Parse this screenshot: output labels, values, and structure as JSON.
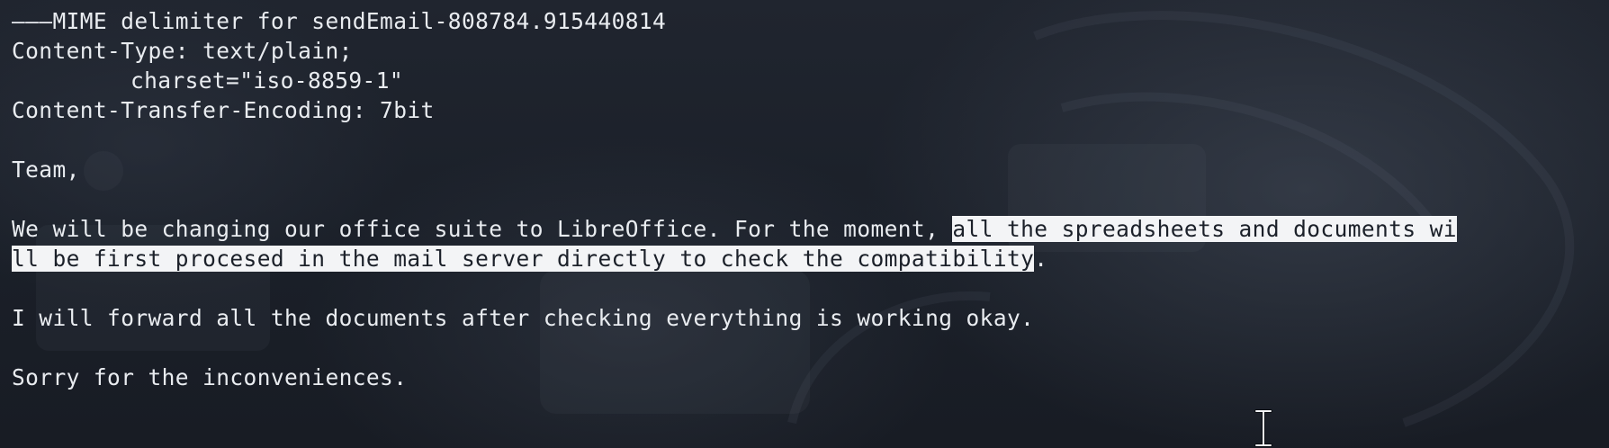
{
  "terminal": {
    "lines": {
      "mime_delimiter": "———MIME delimiter for sendEmail-808784.915440814",
      "content_type": "Content-Type: text/plain;",
      "charset": "charset=\"iso-8859-1\"",
      "encoding": "Content-Transfer-Encoding: 7bit",
      "greeting": "Team,",
      "para1_part1": "We will be changing our office suite to LibreOffice. For the moment, ",
      "para1_selected_1": "all the spreadsheets and documents wi",
      "para1_selected_2": "ll be first procesed in the mail server directly to check the compatibility",
      "para1_end": ".",
      "para2": "I will forward all the documents after checking everything is working okay.",
      "para3": "Sorry for the inconveniences."
    }
  },
  "colors": {
    "background": "#1b2029",
    "text": "#e9ecf0",
    "selection_background": "#f3f4f6",
    "selection_text": "#1b2029"
  },
  "icons": {
    "mouse_cursor": "text-ibeam-cursor-icon"
  }
}
